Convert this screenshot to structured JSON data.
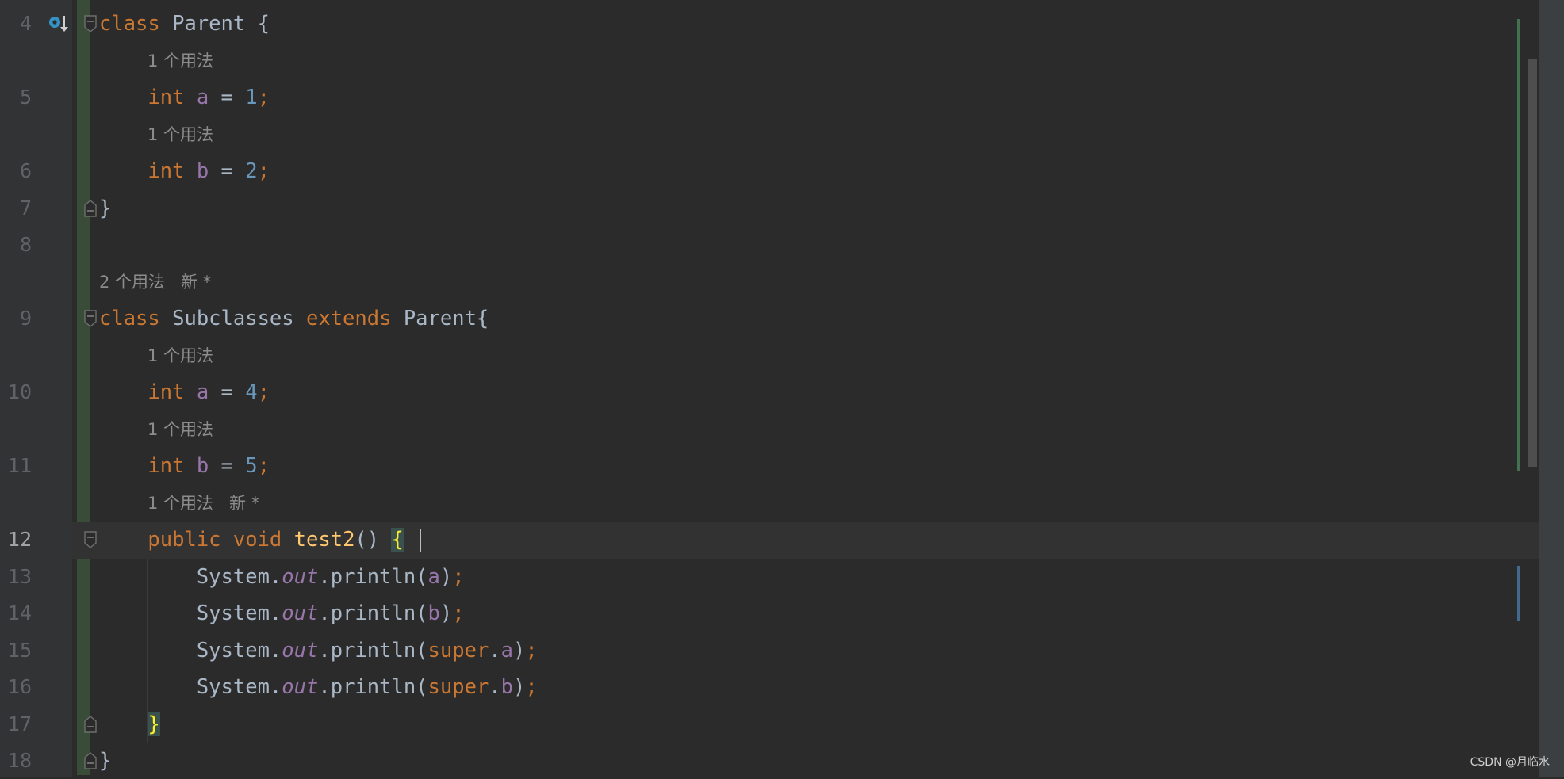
{
  "editor": {
    "current_line": "12",
    "rows": [
      {
        "line": "4",
        "fold": "start",
        "icon": "has-subclasses-icon",
        "tokens": [
          [
            "kw",
            "class"
          ],
          [
            "id",
            " Parent {"
          ]
        ]
      },
      {
        "hint": "1 个用法",
        "indent": 1
      },
      {
        "line": "5",
        "tokens": [
          [
            "kw",
            "    int"
          ],
          [
            "id",
            " "
          ],
          [
            "fld",
            "a"
          ],
          [
            "id",
            " = "
          ],
          [
            "num",
            "1"
          ],
          [
            "kw",
            ";"
          ]
        ]
      },
      {
        "hint": "1 个用法",
        "indent": 1
      },
      {
        "line": "6",
        "tokens": [
          [
            "kw",
            "    int"
          ],
          [
            "id",
            " "
          ],
          [
            "fld",
            "b"
          ],
          [
            "id",
            " = "
          ],
          [
            "num",
            "2"
          ],
          [
            "kw",
            ";"
          ]
        ]
      },
      {
        "line": "7",
        "fold": "end",
        "tokens": [
          [
            "id",
            "}"
          ]
        ]
      },
      {
        "line": "8",
        "tokens": []
      },
      {
        "hint": "2 个用法   新 *",
        "indent": 0
      },
      {
        "line": "9",
        "fold": "start",
        "tokens": [
          [
            "kw",
            "class"
          ],
          [
            "id",
            " Subclasses "
          ],
          [
            "kw",
            "extends"
          ],
          [
            "id",
            " Parent{"
          ]
        ]
      },
      {
        "hint": "1 个用法",
        "indent": 1
      },
      {
        "line": "10",
        "tokens": [
          [
            "kw",
            "    int"
          ],
          [
            "id",
            " "
          ],
          [
            "fld",
            "a"
          ],
          [
            "id",
            " = "
          ],
          [
            "num",
            "4"
          ],
          [
            "kw",
            ";"
          ]
        ]
      },
      {
        "hint": "1 个用法",
        "indent": 1
      },
      {
        "line": "11",
        "tokens": [
          [
            "kw",
            "    int"
          ],
          [
            "id",
            " "
          ],
          [
            "fld",
            "b"
          ],
          [
            "id",
            " = "
          ],
          [
            "num",
            "5"
          ],
          [
            "kw",
            ";"
          ]
        ]
      },
      {
        "hint": "1 个用法   新 *",
        "indent": 1
      },
      {
        "line": "12",
        "fold": "start",
        "tokens": [
          [
            "kw",
            "    public void"
          ],
          [
            "id",
            " "
          ],
          [
            "fn",
            "test2"
          ],
          [
            "id",
            "() "
          ],
          [
            "brace",
            "{"
          ]
        ]
      },
      {
        "line": "13",
        "tokens": [
          [
            "id",
            "        System."
          ],
          [
            "st",
            "out"
          ],
          [
            "id",
            ".println("
          ],
          [
            "fld",
            "a"
          ],
          [
            "id",
            ")"
          ],
          [
            "kw",
            ";"
          ]
        ]
      },
      {
        "line": "14",
        "tokens": [
          [
            "id",
            "        System."
          ],
          [
            "st",
            "out"
          ],
          [
            "id",
            ".println("
          ],
          [
            "fld",
            "b"
          ],
          [
            "id",
            ")"
          ],
          [
            "kw",
            ";"
          ]
        ]
      },
      {
        "line": "15",
        "tokens": [
          [
            "id",
            "        System."
          ],
          [
            "st",
            "out"
          ],
          [
            "id",
            ".println("
          ],
          [
            "kw",
            "super"
          ],
          [
            "id",
            "."
          ],
          [
            "fld",
            "a"
          ],
          [
            "id",
            ")"
          ],
          [
            "kw",
            ";"
          ]
        ]
      },
      {
        "line": "16",
        "tokens": [
          [
            "id",
            "        System."
          ],
          [
            "st",
            "out"
          ],
          [
            "id",
            ".println("
          ],
          [
            "kw",
            "super"
          ],
          [
            "id",
            "."
          ],
          [
            "fld",
            "b"
          ],
          [
            "id",
            ")"
          ],
          [
            "kw",
            ";"
          ]
        ]
      },
      {
        "line": "17",
        "fold": "end",
        "tokens": [
          [
            "id",
            "    "
          ],
          [
            "brace",
            "}"
          ]
        ]
      },
      {
        "line": "18",
        "fold": "end",
        "tokens": [
          [
            "id",
            "}"
          ]
        ]
      }
    ]
  },
  "watermark": "CSDN @月临水",
  "colors": {
    "keyword": "#cc7832",
    "field": "#9876aa",
    "number": "#6897bb",
    "method": "#ffc66d",
    "background": "#2b2b2b"
  }
}
